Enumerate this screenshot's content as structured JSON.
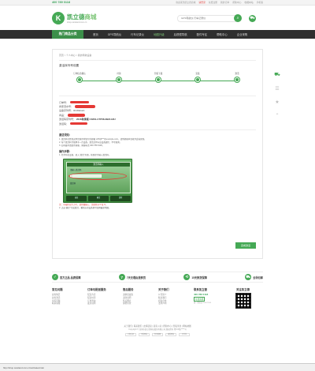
{
  "topbar": {
    "hotline": "400 789 0118",
    "links": [
      "欢迎来到凯立德商城",
      "请登录",
      "免费注册",
      "我的订单",
      "帮助中心",
      "收藏本站",
      "手机版"
    ]
  },
  "header": {
    "logo_mark": "K",
    "logo_name_1": "凯立德",
    "logo_name_2": "商城",
    "logo_url": "shop.careland.com.cn",
    "search_placeholder": "GPS导航仪 行车记录仪"
  },
  "nav": {
    "category": "热门商品分类",
    "items": [
      "首页",
      "GPS导航仪",
      "行车记录仪",
      "地图升级",
      "后视镜导航",
      "配件专区",
      "帮助中心",
      "企业采购"
    ],
    "active_index": 3
  },
  "main": {
    "breadcrumb": "首页 > 个人中心 > 我的导航设备",
    "section_title": "激活序列号设置",
    "steps": [
      "订单信息确认",
      "付款",
      "升级下载",
      "安装",
      "激活"
    ],
    "info": [
      {
        "k": "订单号：",
        "v": "",
        "redact_w": 24,
        "bold": false
      },
      {
        "k": "商家流水号：",
        "v": "",
        "redact_w": 26,
        "bold": false
      },
      {
        "k": "设备序列号：",
        "v": "0018EA2A",
        "redact_w": 0,
        "bold": false
      },
      {
        "k": "商品：",
        "v": "",
        "redact_w": 22,
        "bold": false
      },
      {
        "k": "激活码序列号：",
        "v": "2016秋季版 C3261-C7P08-3B21A0U",
        "redact_w": 0,
        "bold": true
      },
      {
        "k": "激活码：",
        "v": "",
        "redact_w": 22,
        "bold": false
      }
    ],
    "instr_heading": "激活须知：",
    "instr_lines": [
      "1. 激活码已经发送到您购买时填写的邮箱 c25Q9***@example.com，请到邮箱中查收并妥善保管。",
      "2. 每个激活码只能用于一台设备，激活后将与该设备绑定，不可更换。",
      "3. 如有疑问请联系客服，客服电话 400 789 0118。"
    ],
    "instr_heading2": "操作步骤：",
    "instr_step": "1. 打开导航设备，进入“激活”页面，按照提示输入激活码。",
    "device": {
      "title": "激活码输入",
      "row1": "请输入激活码",
      "row2": "激活码",
      "keys": [
        "返回",
        "确定",
        "清除"
      ]
    },
    "instr_note": "注：字母区分大小写，请仔细输入，注意区分 0 和 O。",
    "instr_final": "2. 点击“确定”完成激活，重新启动设备即可使用最新地图。",
    "done_button": "完成激活"
  },
  "sidebar": {
    "icons": [
      "cart-icon",
      "comment-icon",
      "star-icon",
      "top-icon"
    ]
  },
  "guarantees": [
    "官方正品 品质保障",
    "7天无理由退换货",
    "15天换货保障",
    "全场包邮"
  ],
  "footer": {
    "cols": [
      {
        "title": "常见问题",
        "links": [
          "如何购买",
          "如何激活",
          "常见问题",
          "联系客服"
        ]
      },
      {
        "title": "订单与配送服务",
        "links": [
          "配送方式",
          "配送时间",
          "订单查询",
          "发票说明"
        ]
      },
      {
        "title": "售后服务",
        "links": [
          "退换货政策",
          "退款说明",
          "售后网点",
          "保修条款"
        ]
      },
      {
        "title": "关于我们",
        "links": [
          "公司简介",
          "联系我们",
          "招商合作",
          "法律声明"
        ]
      }
    ],
    "contact_title": "联系凯立德",
    "contact_phone": "400 789 0118",
    "contact_online": "在线客服",
    "contact_hours": "周一至周日 9:00-21:00",
    "qr_title": "关注凯立德"
  },
  "copyright": {
    "links": "关于我们 | 联系我们 | 友情链接 | 商家入驻 | 帮助中心 | 隐私条款 | 网站地图",
    "line": "Copyright © 深圳市凯立德科技股份有限公司 版权所有 粤ICP备*****号",
    "badges": [
      "工商认证",
      "可信网站",
      "安全联盟",
      "诚信网站",
      "支付宝"
    ]
  },
  "statusbar": {
    "text": "http://shop.careland.com.cn/activate/order"
  }
}
